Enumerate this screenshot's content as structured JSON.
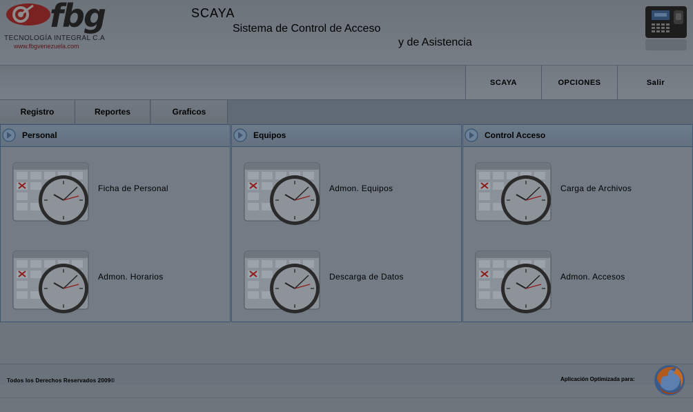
{
  "header": {
    "logo_text": "fbg",
    "logo_tagline": "TECNOLOGÍA INTEGRAL C.A",
    "logo_url": "www.fbgvenezuela.com",
    "app_name": "SCAYA",
    "subtitle_line1": "Sistema de Control de Acceso",
    "subtitle_line2": "y de Asistencia",
    "device_icon": "attendance-terminal-icon"
  },
  "nav": {
    "items": [
      {
        "label": "SCAYA"
      },
      {
        "label": "OPCIONES"
      },
      {
        "label": "Salir"
      }
    ]
  },
  "tabs": [
    {
      "label": "Registro"
    },
    {
      "label": "Reportes"
    },
    {
      "label": "Graficos"
    }
  ],
  "panels": [
    {
      "title": "Personal",
      "items": [
        {
          "label": "Ficha de Personal",
          "icon": "calendar-clock-icon"
        },
        {
          "label": "Admon. Horarios",
          "icon": "calendar-clock-icon"
        }
      ]
    },
    {
      "title": "Equipos",
      "items": [
        {
          "label": "Admon. Equipos",
          "icon": "calendar-clock-icon"
        },
        {
          "label": "Descarga de Datos",
          "icon": "calendar-clock-icon"
        }
      ]
    },
    {
      "title": "Control Acceso",
      "items": [
        {
          "label": "Carga de Archivos",
          "icon": "calendar-clock-icon"
        },
        {
          "label": "Admon. Accesos",
          "icon": "calendar-clock-icon"
        }
      ]
    }
  ],
  "footer": {
    "copyright": "Todos los Derechos Reservados 2009©",
    "optimized_for": "Aplicación Optimizada para:",
    "browser_icon": "firefox-icon"
  },
  "colors": {
    "background": "#6e757d",
    "panel_border": "#3d5570",
    "accent_arrow": "#4a6e92",
    "clock_hand": "#8b1a1a"
  }
}
